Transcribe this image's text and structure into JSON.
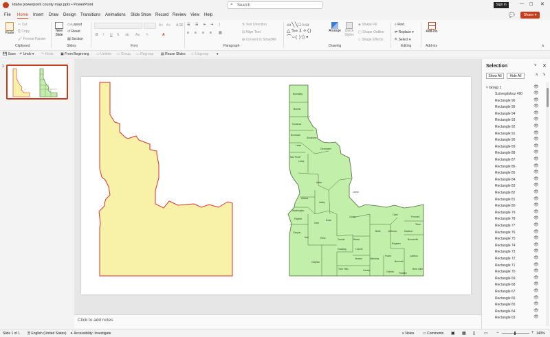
{
  "titlebar": {
    "filename": "Idaho powerpoint county map.pptx",
    "app": "PowerPoint",
    "search_placeholder": "Search",
    "sign_in": "Sign in"
  },
  "menu": {
    "tabs": [
      "File",
      "Home",
      "Insert",
      "Draw",
      "Design",
      "Transitions",
      "Animations",
      "Slide Show",
      "Record",
      "Review",
      "View",
      "Help"
    ],
    "share": "Share"
  },
  "ribbon": {
    "groups": [
      "Clipboard",
      "Slides",
      "Font",
      "Paragraph",
      "Drawing",
      "Editing",
      "Add-ins"
    ],
    "paste": "Paste",
    "cut": "Cut",
    "copy": "Copy",
    "format_painter": "Format Painter",
    "new_slide": "New Slide",
    "layout": "Layout",
    "reset": "Reset",
    "section": "Section",
    "text_direction": "Text Direction",
    "align_text": "Align Text",
    "convert_smartart": "Convert to SmartArt",
    "arrange": "Arrange",
    "quick_styles": "Quick Styles",
    "shape_fill": "Shape Fill",
    "shape_outline": "Shape Outline",
    "shape_effects": "Shape Effects",
    "find": "Find",
    "replace": "Replace",
    "select": "Select",
    "addins": "Add-ins"
  },
  "qat": [
    "Save",
    "Undo",
    "Redo",
    "From Beginning",
    "Reuse Slides",
    "Ungroup",
    "Group",
    "Regroup",
    "Reuse Slides",
    "Ungroup"
  ],
  "qat_items": {
    "save": "Save",
    "undo": "Undo",
    "redo": "Redo",
    "from_beginning": "From Beginning",
    "unhide": "Unhide",
    "group": "Group",
    "regroup": "Regroup",
    "reuse": "Reuse Slides",
    "ungroup": "Ungroup"
  },
  "thumb": {
    "number": "1"
  },
  "notes": {
    "placeholder": "Click to add notes"
  },
  "selection": {
    "title": "Selection",
    "show_all": "Show All",
    "hide_all": "Hide All",
    "group": "Group 1",
    "items": [
      "Szövegdoboz 490",
      "Rectangle 96",
      "Rectangle 95",
      "Rectangle 94",
      "Rectangle 93",
      "Rectangle 92",
      "Rectangle 91",
      "Rectangle 90",
      "Rectangle 89",
      "Rectangle 88",
      "Rectangle 87",
      "Rectangle 86",
      "Rectangle 85",
      "Rectangle 84",
      "Rectangle 83",
      "Rectangle 82",
      "Rectangle 81",
      "Rectangle 80",
      "Rectangle 79",
      "Rectangle 78",
      "Rectangle 77",
      "Rectangle 76",
      "Rectangle 75",
      "Rectangle 74",
      "Rectangle 73",
      "Rectangle 72",
      "Rectangle 71",
      "Rectangle 70",
      "Rectangle 69",
      "Rectangle 68",
      "Rectangle 67",
      "Rectangle 66",
      "Rectangle 65",
      "Rectangle 64",
      "Rectangle 63"
    ]
  },
  "status": {
    "slide": "Slide 1 of 1",
    "language": "English (United States)",
    "accessibility": "Accessibility: Investigate",
    "notes": "Notes",
    "comments": "Comments",
    "zoom": "140%"
  },
  "counties": [
    "Boundary",
    "Bonner",
    "Kootenai",
    "Benewah",
    "Shoshone",
    "Latah",
    "Clearwater",
    "Nez Perce",
    "Lewis",
    "Idaho",
    "Adams",
    "Valley",
    "Lemhi",
    "Washington",
    "Payette",
    "Gem",
    "Boise",
    "Custer",
    "Canyon",
    "Ada",
    "Elmo",
    "Butte",
    "Clark",
    "Fremont",
    "Jefferson",
    "Madison",
    "Teton",
    "Owyhee",
    "Camas",
    "Blaine",
    "Lincoln",
    "Gooding",
    "Jerome",
    "Minidoka",
    "Bingham",
    "Bonneville",
    "Power",
    "Bannock",
    "Caribou",
    "Twin Falls",
    "Cassia",
    "Oneida",
    "Franklin",
    "Bear Lake"
  ],
  "colors": {
    "accent": "#c43e1c",
    "idaho_fill": "#f7f2a8",
    "idaho_stroke": "#d9302c",
    "county_fill": "#c2efa9",
    "county_stroke": "#4a6a3a"
  }
}
